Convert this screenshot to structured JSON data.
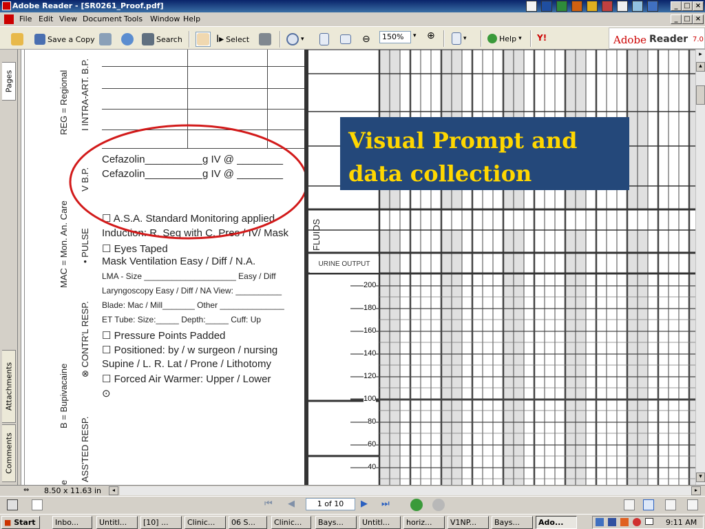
{
  "window": {
    "title": "Adobe Reader - [SR0261_Proof.pdf]"
  },
  "menu": [
    "File",
    "Edit",
    "View",
    "Document",
    "Tools",
    "Window",
    "Help"
  ],
  "toolbar": {
    "save_copy": "Save a Copy",
    "search": "Search",
    "select": "Select",
    "zoom": "150%",
    "help": "Help",
    "brand_adobe": "Adobe",
    "brand_reader": "Reader",
    "brand_version": "7.0"
  },
  "sidebar_tabs": {
    "pages": "Pages",
    "attachments": "Attachments",
    "comments": "Comments"
  },
  "document": {
    "vertical_labels": {
      "reg": "REG = Regional",
      "intra_art": "I INTRA-ART. B.P.",
      "bp": "V B.P.",
      "mac": "MAC = Mon. An. Care",
      "pulse": "• PULSE",
      "bupivacaine": "B = Bupivacaine",
      "contrl_resp": "⊗ CONTR'L RESP.",
      "assted_resp": "ASS'TED RESP.",
      "fluids": "FLUIDS"
    },
    "form_lines": [
      "Cefazolin__________g IV @ ________",
      "Cefazolin__________g IV @ ________",
      "☐ A.S.A. Standard Monitoring applied",
      "Induction: R. Seq with C. Pres / IV/ Mask",
      "☐ Eyes Taped",
      "Mask Ventilation   Easy / Diff / N.A."
    ],
    "form_lines_small": [
      "LMA - Size ____________________ Easy / Diff",
      "Laryngoscopy  Easy / Diff / NA  View: __________",
      "Blade: Mac / Mill_______  Other ______________",
      "ET Tube: Size:_____  Depth:_____  Cuff: Up"
    ],
    "form_lines_2": [
      "☐ Pressure Points Padded",
      "☐ Positioned: by / w    surgeon / nursing",
      "   Supine / L. R. Lat / Prone / Lithotomy",
      "☐ Forced Air Warmer:  Upper / Lower",
      "⊙"
    ],
    "urine_output": "URINE OUTPUT",
    "scale": [
      "200",
      "180",
      "160",
      "140",
      "120",
      "100",
      "80",
      "60",
      "40"
    ],
    "overlay_line1": "Visual Prompt and",
    "overlay_line2": "data collection"
  },
  "statusbar": {
    "page_size": "8.50 x 11.63 in"
  },
  "navbar": {
    "page": "1 of 10"
  },
  "taskbar": {
    "start": "Start",
    "tasks": [
      "Inbo...",
      "Untitl...",
      "[10] ...",
      "Clinic...",
      "06 S...",
      "Clinic...",
      "Bays...",
      "Untitl...",
      "horiz...",
      "V1NP...",
      "Bays...",
      "Ado..."
    ],
    "clock": "9:11 AM"
  },
  "colors": {
    "overlay_bg": "#24487a",
    "overlay_text": "#ffd700",
    "highlight_ellipse": "#d21a1a",
    "grid_shade": "#e0e0e0"
  }
}
